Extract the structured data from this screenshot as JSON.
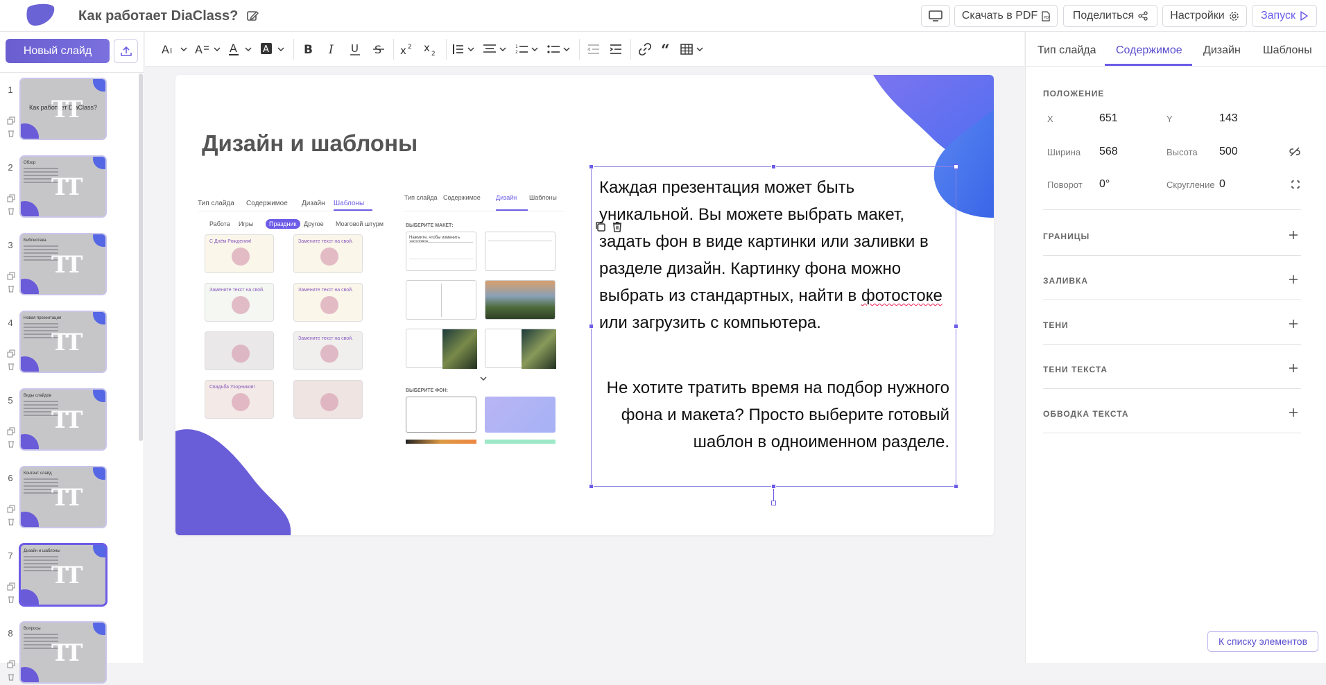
{
  "header": {
    "title": "Как работает DiaClass?",
    "buttons": {
      "download_pdf": "Скачать в PDF",
      "share": "Поделиться",
      "settings": "Настройки",
      "run": "Запуск"
    }
  },
  "sidebar": {
    "new_slide": "Новый слайд",
    "slides": [
      {
        "num": "1",
        "label": "Как работает DiaClass?"
      },
      {
        "num": "2",
        "label": "Обзор"
      },
      {
        "num": "3",
        "label": "Библиотека"
      },
      {
        "num": "4",
        "label": "Новая презентация"
      },
      {
        "num": "5",
        "label": "Виды слайдов"
      },
      {
        "num": "6",
        "label": "Контент слайд"
      },
      {
        "num": "7",
        "label": "Дизайн и шаблоны"
      },
      {
        "num": "8",
        "label": "Вопросы"
      }
    ],
    "active_index": 6
  },
  "toolbar": {
    "icons": [
      "text-size-icon",
      "line-height-icon",
      "text-color-icon",
      "highlight-icon",
      "bold-icon",
      "italic-icon",
      "underline-icon",
      "strikethrough-icon",
      "superscript-icon",
      "subscript-icon",
      "spacing-icon",
      "align-icon",
      "numbered-list-icon",
      "bullet-list-icon",
      "outdent-icon",
      "indent-icon",
      "link-icon",
      "quote-icon",
      "table-icon"
    ]
  },
  "right_panel": {
    "tabs": [
      "Тип слайда",
      "Содержимое",
      "Дизайн",
      "Шаблоны"
    ],
    "active_tab": "Содержимое",
    "position": {
      "title": "ПОЛОЖЕНИЕ",
      "x_label": "X",
      "x": "651",
      "y_label": "Y",
      "y": "143",
      "width_label": "Ширина",
      "width": "568",
      "height_label": "Высота",
      "height": "500",
      "rotation_label": "Поворот",
      "rotation": "0°",
      "radius_label": "Скругление",
      "radius": "0"
    },
    "sections": [
      "ГРАНИЦЫ",
      "ЗАЛИВКА",
      "ТЕНИ",
      "ТЕНИ ТЕКСТА",
      "ОБВОДКА ТЕКСТА"
    ],
    "list_button": "К списку элементов"
  },
  "slide": {
    "title": "Дизайн и шаблоны",
    "screenshot_templates": {
      "tabs": [
        "Тип слайда",
        "Содержимое",
        "Дизайн",
        "Шаблоны"
      ],
      "filters": [
        "Работа",
        "Игры",
        "Праздник",
        "Другое",
        "Мозговой штурм"
      ],
      "cards": [
        "С Днём Рождения!",
        "Замените текст на свой.",
        "Замените текст на свой.",
        "Замените текст на свой.",
        "",
        "Замените текст на свой.",
        "Свадьба Узорников!",
        ""
      ]
    },
    "screenshot_design": {
      "tabs": [
        "Тип слайда",
        "Содержимое",
        "Дизайн",
        "Шаблоны"
      ],
      "layout_label": "ВЫБЕРИТЕ МАКЕТ:",
      "layout_hint": "Нажмите, чтобы изменить заголовок",
      "bg_label": "ВЫБЕРИТЕ ФОН:"
    },
    "paragraph1_before": "Каждая презентация может быть уникальной. Вы можете выбрать макет, задать фон в виде картинки или заливки в разделе дизайн. Картинку фона можно выбрать из стандартных, найти в ",
    "paragraph1_misspelled": "фотостоке",
    "paragraph1_after": " или загрузить с компьютера.",
    "paragraph2": "Не хотите тратить время на подбор нужного фона и макета? Просто выберите готовый шаблон в одноименном разделе."
  },
  "colors": {
    "accent": "#6c5ce7",
    "blob_violet": "#6a5ed8",
    "blob_blue": "#4f7df0"
  }
}
